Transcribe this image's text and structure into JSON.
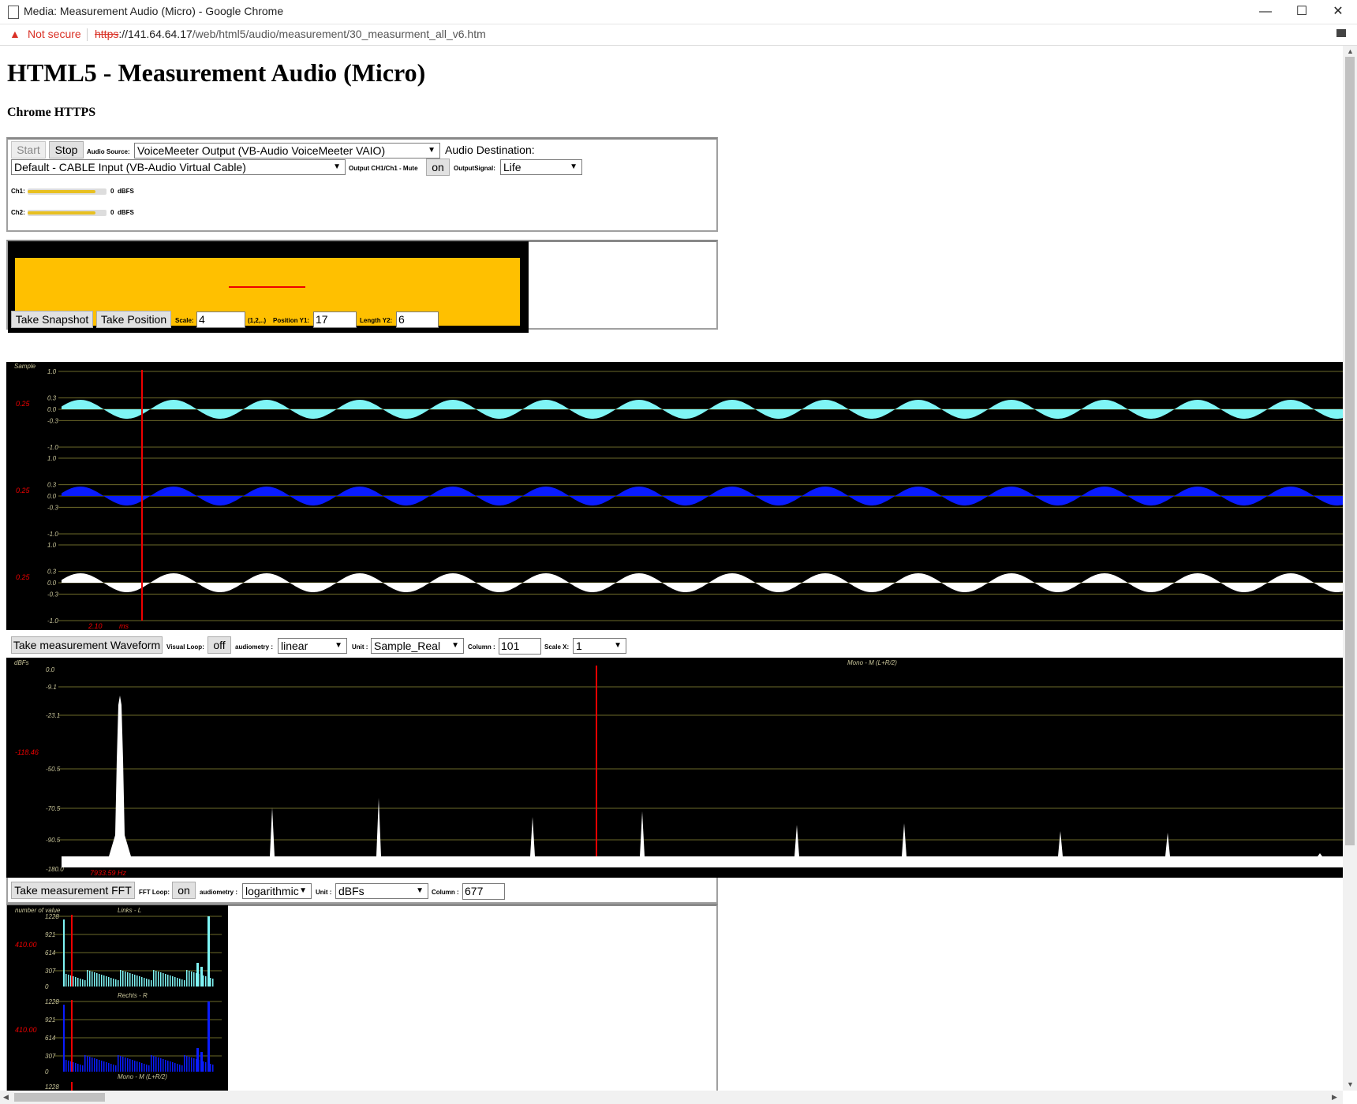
{
  "window": {
    "title": "Media: Measurement Audio (Micro) - Google Chrome",
    "minimize": "—",
    "maximize": "☐",
    "close": "✕"
  },
  "address": {
    "warning_icon": "warning-triangle-icon",
    "not_secure": "Not secure",
    "url_proto": "https",
    "url_host": "://141.64.64.17",
    "url_path": "/web/html5/audio/measurement/30_measurment_all_v6.htm"
  },
  "page": {
    "heading": "HTML5 - Measurement Audio (Micro)",
    "subheading": "Chrome HTTPS"
  },
  "controls": {
    "start": "Start",
    "stop": "Stop",
    "audio_source_label": "Audio Source:",
    "audio_source_value": "VoiceMeeter Output (VB-Audio VoiceMeeter VAIO)",
    "audio_destination_label": "Audio Destination:",
    "audio_destination_value": "Default - CABLE Input (VB-Audio Virtual Cable)",
    "output_mute_label": "Output CH1/Ch1 - Mute",
    "output_mute_btn": "on",
    "output_signal_label": "OutputSignal:",
    "output_signal_value": "Life",
    "ch1_label": "Ch1:",
    "ch1_value": "0",
    "ch1_unit": "dBFS",
    "ch1_level": 0.86,
    "ch2_label": "Ch2:",
    "ch2_value": "0",
    "ch2_unit": "dBFS",
    "ch2_level": 0.86
  },
  "snapshot": {
    "take_snapshot": "Take Snapshot",
    "take_position": "Take Position",
    "scale_label": "Scale:",
    "scale_value": "4",
    "scale_hint": "(1,2,..)",
    "pos_y1_label": "Position Y1:",
    "pos_y1_value": "17",
    "len_y2_label": "Length Y2:",
    "len_y2_value": "6"
  },
  "waveform": {
    "sample_label": "Sample",
    "ticks": [
      "1.0",
      "0.3",
      "0.0",
      "-0.3",
      "-1.0"
    ],
    "marker_value": "0.25",
    "time_readout": "2.10",
    "time_unit": "ms",
    "take_btn": "Take measurement Waveform",
    "visual_loop_label": "Visual Loop:",
    "visual_loop_btn": "off",
    "audiometry_label": "audiometry :",
    "audiometry_value": "linear",
    "unit_label": "Unit :",
    "unit_value": "Sample_Real",
    "column_label": "Column :",
    "column_value": "101",
    "scalex_label": "Scale X:",
    "scalex_value": "1",
    "colors": [
      "#7ff5f5",
      "#0a1cff",
      "#ffffff"
    ]
  },
  "fft": {
    "unit_label_top": "dBFs",
    "channel_label": "Mono - M (L+R/2)",
    "ticks": [
      "0.0",
      "-9.1",
      "-23.1",
      "-50.5",
      "-70.5",
      "-90.5",
      "-180.0"
    ],
    "marker_value": "-118.46",
    "freq_readout": "7933.59 Hz",
    "take_btn": "Take measurement FFT",
    "loop_label": "FFT Loop:",
    "loop_btn": "on",
    "audiometry_label": "audiometry :",
    "audiometry_value": "logarithmic",
    "unit_label": "Unit :",
    "unit_value": "dBFs",
    "column_label": "Column :",
    "column_value": "677"
  },
  "histogram": {
    "top_label": "number of value",
    "ch_left": "Links - L",
    "ch_right": "Rechts - R",
    "ch_mono": "Mono - M (L+R/2)",
    "ticks": [
      "1228",
      "921",
      "614",
      "307",
      "0"
    ],
    "marker_value": "410.00",
    "bottom_tick": "1228"
  }
}
